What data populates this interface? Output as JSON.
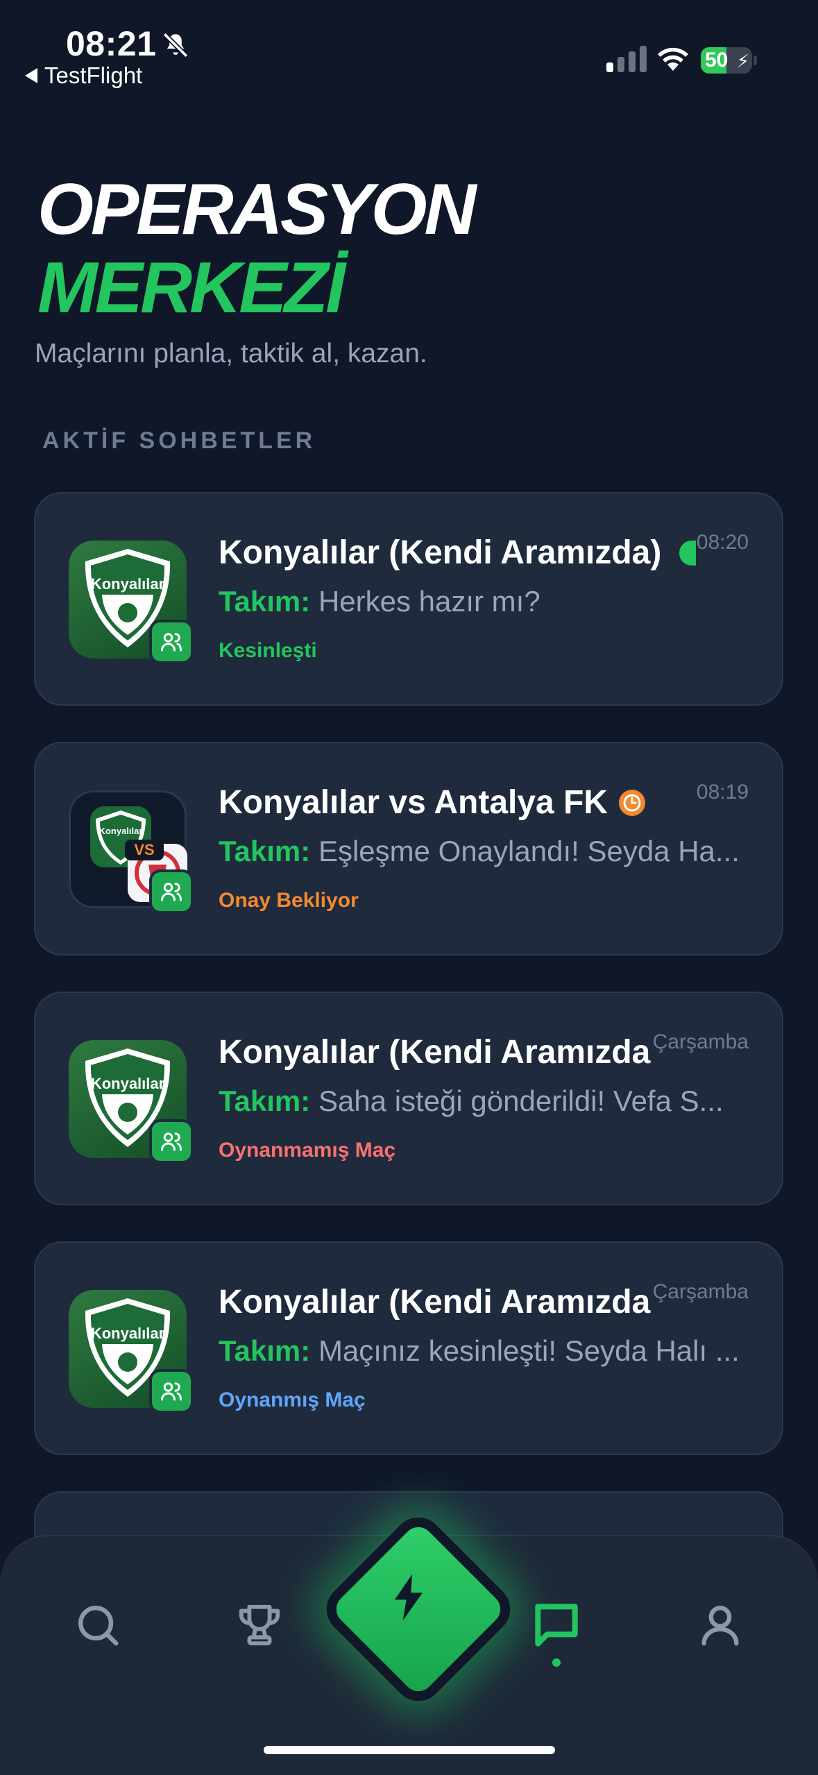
{
  "status_bar": {
    "time": "08:21",
    "back_app": "TestFlight",
    "battery": "50",
    "battery_level": 0.5
  },
  "header": {
    "title_line1": "OPERASYON",
    "title_line2": "MERKEZİ",
    "subtitle": "Maçlarını planla, taktik al, kazan."
  },
  "section_label": "AKTİF SOHBETLER",
  "colors": {
    "accent": "#22c55e",
    "background": "#0f1729",
    "card": "#1f2a3d",
    "status_confirmed": "#22c55e",
    "status_pending": "#f28a2e",
    "status_unplayed": "#f87171",
    "status_played": "#60a5fa"
  },
  "chats": [
    {
      "title": "Konyalılar (Kendi Aramızda)",
      "time": "08:20",
      "prefix": "Takım:",
      "message": "Herkes hazır mı?",
      "status": "Kesinleşti",
      "avatar_text": "Konyalılar"
    },
    {
      "title": "Konyalılar vs Antalya FK",
      "time": "08:19",
      "prefix": "Takım:",
      "message": "Eşleşme Onaylandı! Seyda Ha...",
      "status": "Onay Bekliyor",
      "avatar_text": "Konyalılar",
      "vs_label": "VS"
    },
    {
      "title": "Konyalılar (Kendi Aramızda",
      "time": "Çarşamba",
      "prefix": "Takım:",
      "message": "Saha isteği gönderildi! Vefa S...",
      "status": "Oynanmamış Maç",
      "avatar_text": "Konyalılar"
    },
    {
      "title": "Konyalılar (Kendi Aramızda",
      "time": "Çarşamba",
      "prefix": "Takım:",
      "message": "Maçınız kesinleşti! Seyda Halı ...",
      "status": "Oynanmış Maç",
      "avatar_text": "Konyalılar"
    }
  ],
  "nav": {
    "items": [
      "search-icon",
      "trophy-icon",
      "bolt-icon",
      "chat-icon",
      "user-icon"
    ],
    "active": "chat-icon"
  }
}
